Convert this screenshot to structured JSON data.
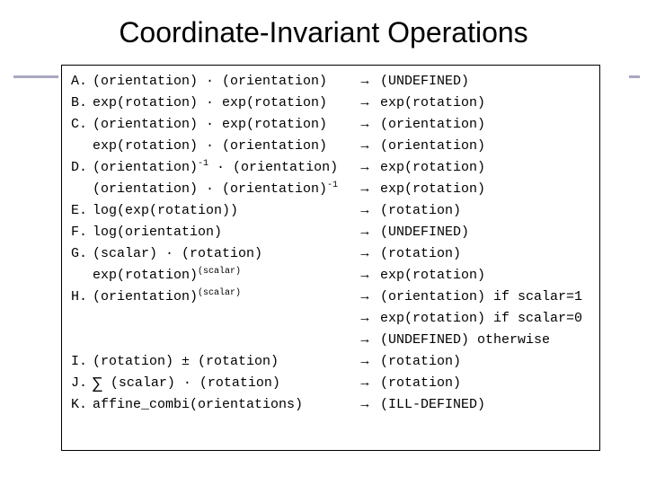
{
  "title": "Coordinate-Invariant Operations",
  "rows": [
    {
      "label": "A.",
      "lhs": "(orientation) · (orientation)",
      "rhs": "(UNDEFINED)"
    },
    {
      "label": "B.",
      "lhs": "exp(rotation) · exp(rotation)",
      "rhs": "exp(rotation)"
    },
    {
      "label": "C.",
      "lhs": "(orientation) · exp(rotation)",
      "rhs": "(orientation)"
    },
    {
      "label": "",
      "lhs": "exp(rotation) · (orientation)",
      "rhs": "(orientation)"
    },
    {
      "label": "D.",
      "lhs_html": "(orientation)<sup>-1</sup> · (orientation)",
      "rhs": "exp(rotation)"
    },
    {
      "label": "",
      "lhs_html": "(orientation) · (orientation)<sup>-1</sup>",
      "rhs": "exp(rotation)"
    },
    {
      "label": "E.",
      "lhs": "log(exp(rotation))",
      "rhs": "(rotation)"
    },
    {
      "label": "F.",
      "lhs": "log(orientation)",
      "rhs": "(UNDEFINED)"
    },
    {
      "label": "G.",
      "lhs": "(scalar) · (rotation)",
      "rhs": "(rotation)"
    },
    {
      "label": "",
      "lhs_html": "exp(rotation)<sup>(scalar)</sup>",
      "rhs": "exp(rotation)"
    },
    {
      "label": "H.",
      "lhs_html": "(orientation)<sup>(scalar)</sup>",
      "rhs": "(orientation) if scalar=1"
    },
    {
      "label": "",
      "lhs": "",
      "rhs": "exp(rotation) if scalar=0"
    },
    {
      "label": "",
      "lhs": "",
      "rhs": "(UNDEFINED)   otherwise"
    },
    {
      "label": "I.",
      "lhs": "(rotation) ± (rotation)",
      "rhs": "(rotation)"
    },
    {
      "label": "J.",
      "lhs_html": "<span class=\"sum\">∑</span> (scalar) · (rotation)",
      "rhs": "(rotation)"
    },
    {
      "label": "K.",
      "lhs": "affine_combi(orientations)",
      "rhs": "(ILL-DEFINED)"
    }
  ],
  "arrow": "→"
}
